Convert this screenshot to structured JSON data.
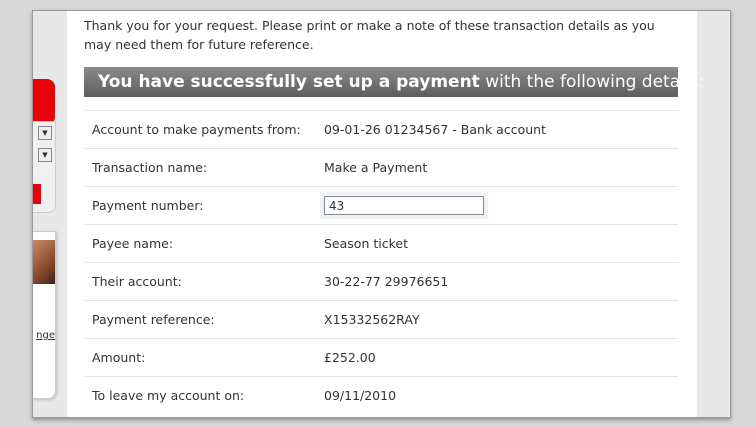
{
  "intro": "Thank you for your request. Please print or make a note of these transaction details as you may need them for future reference.",
  "banner": {
    "bold": "You have successfully set up a payment",
    "rest": " with the following details:"
  },
  "details": [
    {
      "label": "Account to make payments from:",
      "value": "09-01-26 01234567 - Bank account"
    },
    {
      "label": "Transaction name:",
      "value": "Make a Payment"
    },
    {
      "label": "Payment number:",
      "value": "43"
    },
    {
      "label": "Payee name:",
      "value": "Season ticket"
    },
    {
      "label": "Their account:",
      "value": "30-22-77 29976651"
    },
    {
      "label": "Payment reference:",
      "value": "X15332562RAY"
    },
    {
      "label": "Amount:",
      "value": "£252.00"
    },
    {
      "label": "To leave my account on:",
      "value": "09/11/2010"
    }
  ],
  "sidebar": {
    "link_fragment": "nge"
  }
}
